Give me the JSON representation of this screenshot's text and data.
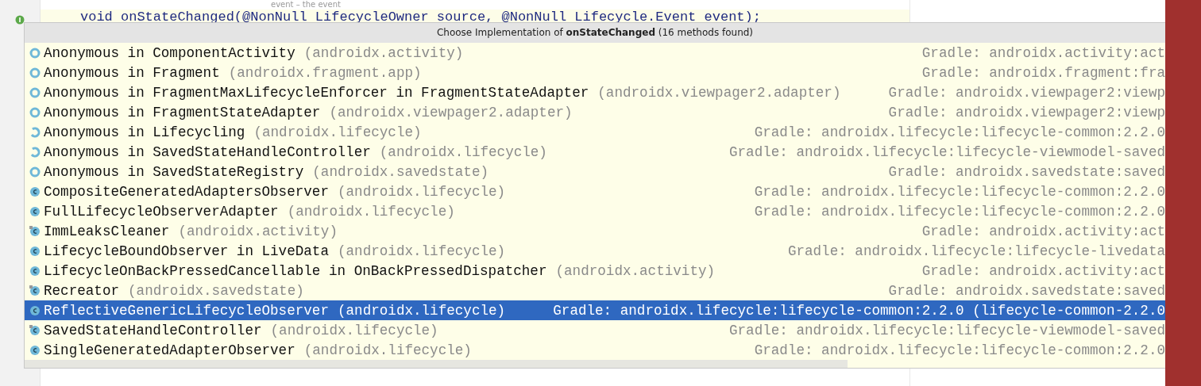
{
  "editor": {
    "doc_line": "event – the event",
    "code_line": "void onStateChanged(@NonNull LifecycleOwner source, @NonNull Lifecycle.Event event);"
  },
  "popup": {
    "title": "Choose Implementation of **onStateChanged** (16 methods found)",
    "items": [
      {
        "kind": "anonymous",
        "name": "Anonymous in ComponentActivity",
        "package": "(androidx.activity)",
        "location": "Gradle: androidx.activity:act",
        "selected": false
      },
      {
        "kind": "anonymous",
        "name": "Anonymous in Fragment",
        "package": "(androidx.fragment.app)",
        "location": "Gradle: androidx.fragment:fra",
        "selected": false
      },
      {
        "kind": "anonymous",
        "name": "Anonymous in FragmentMaxLifecycleEnforcer in FragmentStateAdapter",
        "package": "(androidx.viewpager2.adapter)",
        "location": "Gradle: androidx.viewpager2:viewp",
        "selected": false
      },
      {
        "kind": "anonymous",
        "name": "Anonymous in FragmentStateAdapter",
        "package": "(androidx.viewpager2.adapter)",
        "location": "Gradle: androidx.viewpager2:viewp",
        "selected": false
      },
      {
        "kind": "anonymous-partial",
        "name": "Anonymous in Lifecycling",
        "package": "(androidx.lifecycle)",
        "location": "Gradle: androidx.lifecycle:lifecycle-common:2.2.0",
        "selected": false
      },
      {
        "kind": "anonymous-partial",
        "name": "Anonymous in SavedStateHandleController",
        "package": "(androidx.lifecycle)",
        "location": "Gradle: androidx.lifecycle:lifecycle-viewmodel-saved",
        "selected": false
      },
      {
        "kind": "anonymous",
        "name": "Anonymous in SavedStateRegistry",
        "package": "(androidx.savedstate)",
        "location": "Gradle: androidx.savedstate:saved",
        "selected": false
      },
      {
        "kind": "class",
        "name": "CompositeGeneratedAdaptersObserver",
        "package": "(androidx.lifecycle)",
        "location": "Gradle: androidx.lifecycle:lifecycle-common:2.2.0",
        "selected": false
      },
      {
        "kind": "class",
        "name": "FullLifecycleObserverAdapter",
        "package": "(androidx.lifecycle)",
        "location": "Gradle: androidx.lifecycle:lifecycle-common:2.2.0",
        "selected": false
      },
      {
        "kind": "class-inner",
        "name": "ImmLeaksCleaner",
        "package": "(androidx.activity)",
        "location": "Gradle: androidx.activity:act",
        "selected": false
      },
      {
        "kind": "class",
        "name": "LifecycleBoundObserver in LiveData",
        "package": "(androidx.lifecycle)",
        "location": "Gradle: androidx.lifecycle:lifecycle-livedata",
        "selected": false
      },
      {
        "kind": "class",
        "name": "LifecycleOnBackPressedCancellable in OnBackPressedDispatcher",
        "package": "(androidx.activity)",
        "location": "Gradle: androidx.activity:act",
        "selected": false
      },
      {
        "kind": "class-inner",
        "name": "Recreator",
        "package": "(androidx.savedstate)",
        "location": "Gradle: androidx.savedstate:saved",
        "selected": false
      },
      {
        "kind": "class",
        "name": "ReflectiveGenericLifecycleObserver",
        "package": "(androidx.lifecycle)",
        "location": "Gradle: androidx.lifecycle:lifecycle-common:2.2.0 (lifecycle-common-2.2.0",
        "selected": true
      },
      {
        "kind": "class-inner",
        "name": "SavedStateHandleController",
        "package": "(androidx.lifecycle)",
        "location": "Gradle: androidx.lifecycle:lifecycle-viewmodel-saved",
        "selected": false
      },
      {
        "kind": "class",
        "name": "SingleGeneratedAdapterObserver",
        "package": "(androidx.lifecycle)",
        "location": "Gradle: androidx.lifecycle:lifecycle-common:2.2.0",
        "selected": false
      }
    ]
  }
}
